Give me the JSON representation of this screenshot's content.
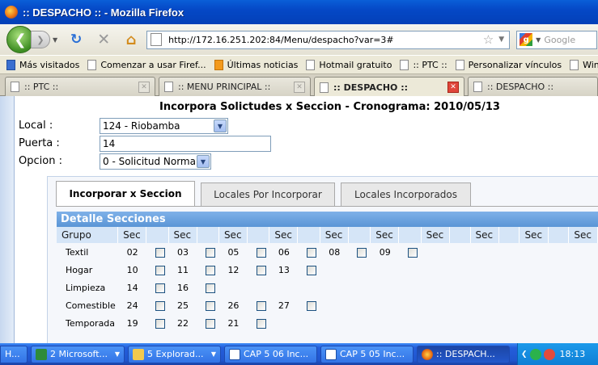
{
  "window": {
    "title": ":: DESPACHO :: - Mozilla Firefox"
  },
  "nav": {
    "url": "http://172.16.251.202:84/Menu/despacho?var=3#",
    "search_placeholder": "Google"
  },
  "bookmarks": [
    {
      "label": "Más visitados"
    },
    {
      "label": "Comenzar a usar Firef..."
    },
    {
      "label": "Últimas noticias"
    },
    {
      "label": "Hotmail gratuito"
    },
    {
      "label": ":: PTC ::"
    },
    {
      "label": "Personalizar vínculos"
    },
    {
      "label": "Windows Media"
    }
  ],
  "tabs": [
    {
      "label": ":: PTC ::"
    },
    {
      "label": ":: MENU PRINCIPAL ::"
    },
    {
      "label": ":: DESPACHO ::"
    },
    {
      "label": ":: DESPACHO ::"
    }
  ],
  "page": {
    "heading": "Incorpora Solictudes x Seccion - Cronograma: 2010/05/13",
    "local_label": "Local :",
    "local_value": "124 - Riobamba",
    "puerta_label": "Puerta :",
    "puerta_value": "14",
    "opcion_label": "Opcion :",
    "opcion_value": "0 - Solicitud Normal"
  },
  "panel_tabs": [
    {
      "label": "Incorporar x Seccion"
    },
    {
      "label": "Locales Por Incorporar"
    },
    {
      "label": "Locales Incorporados"
    }
  ],
  "grid": {
    "title": "Detalle Secciones",
    "group_header": "Grupo",
    "sec_header": "Sec",
    "rows": [
      {
        "grupo": "Textil",
        "secs": [
          "02",
          "03",
          "05",
          "06",
          "08",
          "09"
        ]
      },
      {
        "grupo": "Hogar",
        "secs": [
          "10",
          "11",
          "12",
          "13"
        ]
      },
      {
        "grupo": "Limpieza",
        "secs": [
          "14",
          "16"
        ]
      },
      {
        "grupo": "Comestible",
        "secs": [
          "24",
          "25",
          "26",
          "27"
        ]
      },
      {
        "grupo": "Temporada",
        "secs": [
          "19",
          "22",
          "21"
        ]
      }
    ]
  },
  "taskbar": {
    "items": [
      {
        "label": "H..."
      },
      {
        "label": "2 Microsoft..."
      },
      {
        "label": "5 Explorad..."
      },
      {
        "label": "CAP 5 06 Inc..."
      },
      {
        "label": "CAP 5 05 Inc..."
      },
      {
        "label": ":: DESPACH..."
      }
    ],
    "clock": "18:13"
  }
}
